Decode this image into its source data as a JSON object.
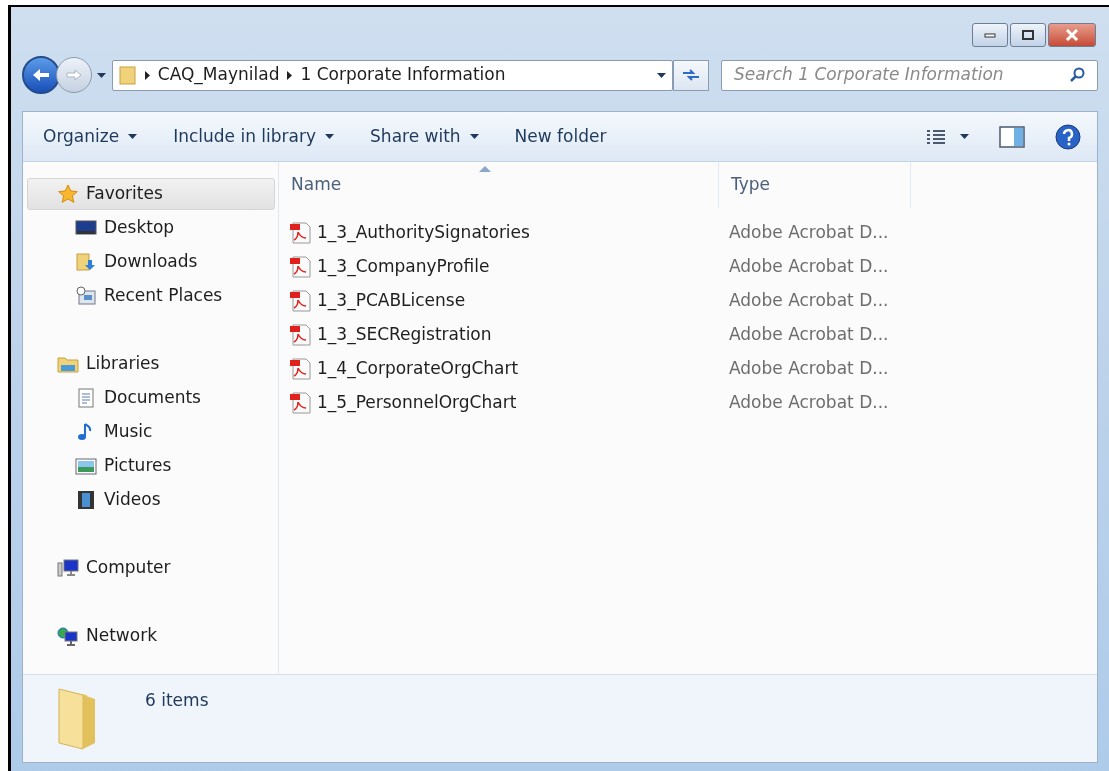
{
  "address": {
    "crumbs": [
      "CAQ_Maynilad",
      "1 Corporate Information"
    ]
  },
  "search": {
    "placeholder": "Search 1 Corporate Information"
  },
  "toolbar": {
    "items": [
      {
        "label": "Organize",
        "dropdown": true
      },
      {
        "label": "Include in library",
        "dropdown": true
      },
      {
        "label": "Share with",
        "dropdown": true
      },
      {
        "label": "New folder",
        "dropdown": false
      }
    ]
  },
  "sidebar": {
    "groups": [
      {
        "label": "Favorites",
        "kind": "star",
        "selected": true,
        "children": [
          {
            "label": "Desktop",
            "kind": "desktop",
            "selected": false
          },
          {
            "label": "Downloads",
            "kind": "downloads",
            "selected": false
          },
          {
            "label": "Recent Places",
            "kind": "recent",
            "selected": false
          }
        ]
      },
      {
        "label": "Libraries",
        "kind": "libraries",
        "selected": false,
        "children": [
          {
            "label": "Documents",
            "kind": "documents",
            "selected": false
          },
          {
            "label": "Music",
            "kind": "music",
            "selected": false
          },
          {
            "label": "Pictures",
            "kind": "pictures",
            "selected": false
          },
          {
            "label": "Videos",
            "kind": "videos",
            "selected": false
          }
        ]
      },
      {
        "label": "Computer",
        "kind": "computer",
        "selected": false
      },
      {
        "label": "Network",
        "kind": "network",
        "selected": false
      }
    ]
  },
  "table": {
    "columns": [
      {
        "label": "Name",
        "sorted": true
      },
      {
        "label": "Type",
        "sorted": false
      }
    ],
    "rows": [
      {
        "name": "1_3_AuthoritySignatories",
        "type": "Adobe Acrobat D..."
      },
      {
        "name": "1_3_CompanyProfile",
        "type": "Adobe Acrobat D..."
      },
      {
        "name": "1_3_PCABLicense",
        "type": "Adobe Acrobat D..."
      },
      {
        "name": "1_3_SECRegistration",
        "type": "Adobe Acrobat D..."
      },
      {
        "name": "1_4_CorporateOrgChart",
        "type": "Adobe Acrobat D..."
      },
      {
        "name": "1_5_PersonnelOrgChart",
        "type": "Adobe Acrobat D..."
      }
    ]
  },
  "status_bar": {
    "text": "6 items"
  }
}
